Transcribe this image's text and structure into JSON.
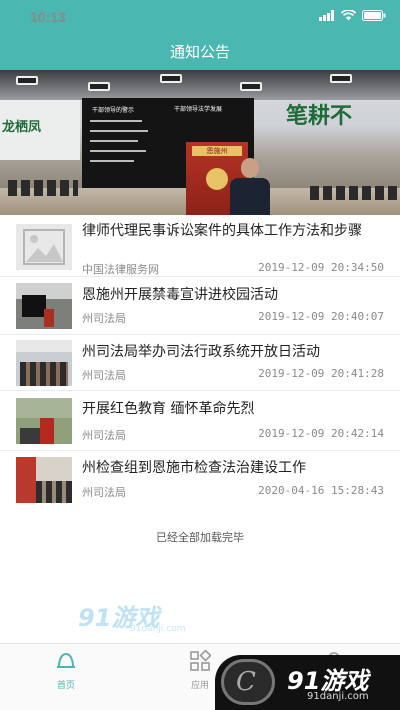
{
  "status_bar": {
    "time": "10:13"
  },
  "nav": {
    "title": "通知公告"
  },
  "hero": {
    "calligraphy_left": "龙栖凤",
    "calligraphy_right": "笔耕不",
    "screen_title_left": "干部领导的警示",
    "screen_title_right": "干部领导法学发展",
    "podium_plate": "恩施州"
  },
  "items": [
    {
      "title": "律师代理民事诉讼案件的具体工作方法和步骤",
      "source": "中国法律服务网",
      "time": "2019-12-09 20:34:50",
      "thumb": "image-placeholder-icon"
    },
    {
      "title": "恩施州开展禁毒宣讲进校园活动",
      "source": "州司法局",
      "time": "2019-12-09 20:40:07",
      "thumb": "photo"
    },
    {
      "title": "州司法局举办司法行政系统开放日活动",
      "source": "州司法局",
      "time": "2019-12-09 20:41:28",
      "thumb": "photo"
    },
    {
      "title": "开展红色教育 缅怀革命先烈",
      "source": "州司法局",
      "time": "2019-12-09 20:42:14",
      "thumb": "photo"
    },
    {
      "title": "州检查组到恩施市检查法治建设工作",
      "source": "州司法局",
      "time": "2020-04-16 15:28:43",
      "thumb": "photo"
    }
  ],
  "footer_text": "已经全部加载完毕",
  "watermark": {
    "logo": "91游戏",
    "url": "91danji.com"
  },
  "tabs": [
    {
      "label": "首页",
      "icon": "home-icon",
      "active": true
    },
    {
      "label": "应用",
      "icon": "apps-icon",
      "active": false
    },
    {
      "label": "",
      "icon": "user-icon",
      "active": false
    }
  ],
  "badge": {
    "brand": "91游戏",
    "url": "91danji.com",
    "logo_letter": "C"
  },
  "colors": {
    "accent": "#4ab7b1",
    "active_tab": "#4ab7b1",
    "inactive_tab": "#9a9a9a"
  }
}
